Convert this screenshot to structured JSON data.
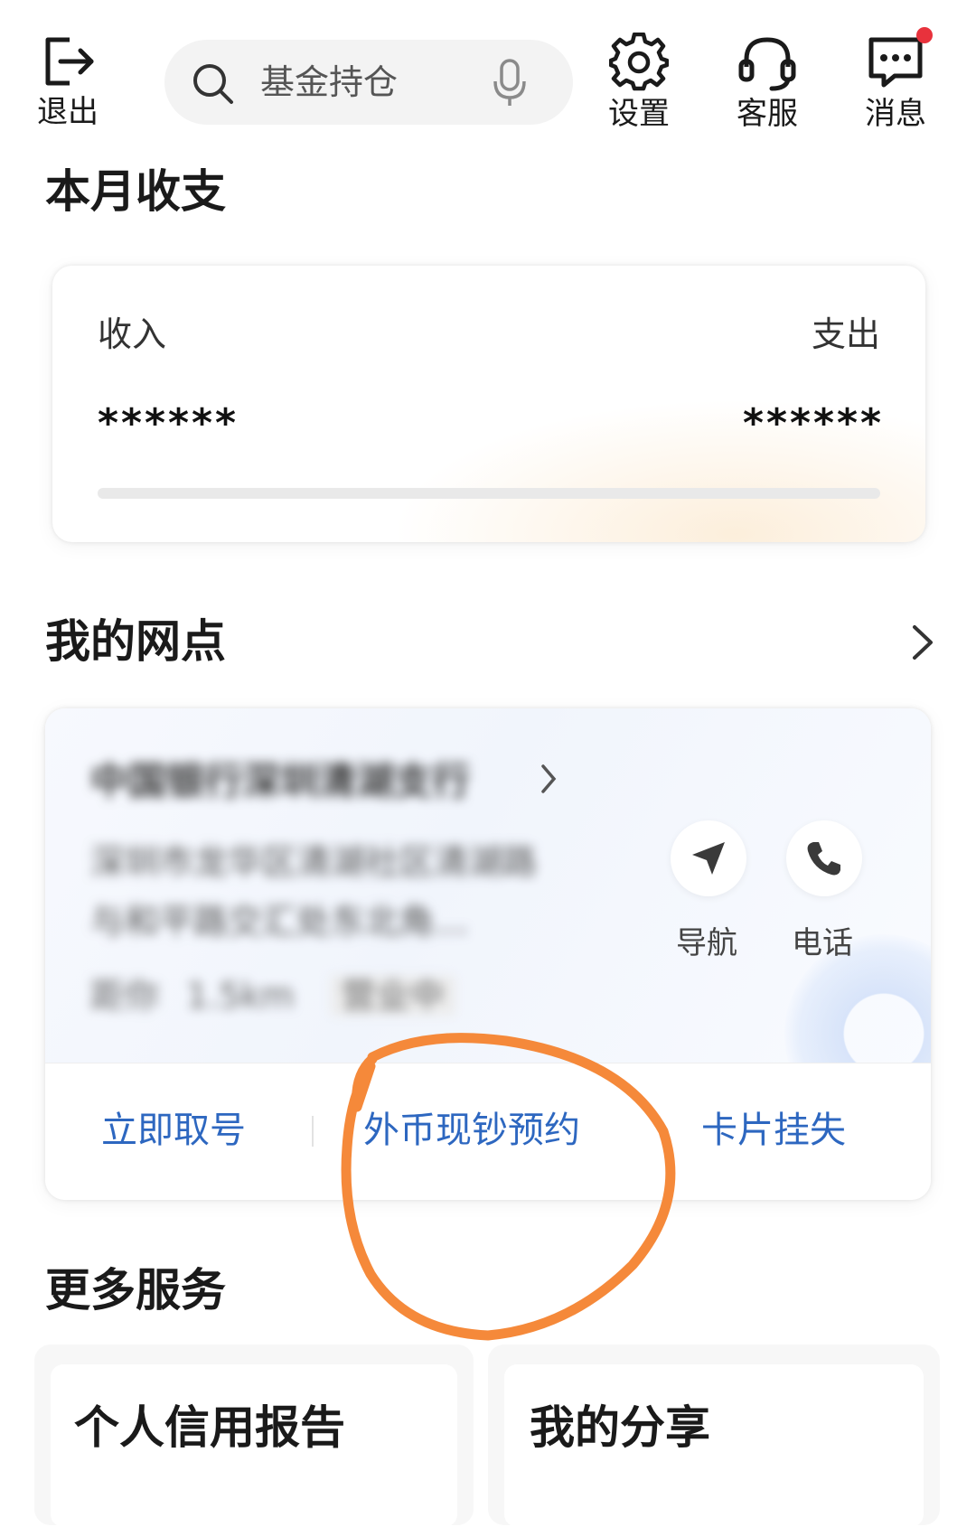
{
  "top_bar": {
    "logout_label": "退出",
    "search_placeholder": "基金持仓",
    "settings_label": "设置",
    "service_label": "客服",
    "messages_label": "消息",
    "has_unread": true
  },
  "monthly": {
    "title": "本月收支",
    "income_label": "收入",
    "expense_label": "支出",
    "income_value": "******",
    "expense_value": "******",
    "progress": 0
  },
  "branch": {
    "section_title": "我的网点",
    "name": "中国银行深圳清湖支行",
    "address_line1": "深圳市龙华区清湖社区清湖路",
    "address_line2": "与和平路交汇处东北角…",
    "distance_prefix": "距你",
    "distance_value": "1.5km",
    "hours": "营业中",
    "nav_label": "导航",
    "phone_label": "电话",
    "actions": [
      {
        "label": "立即取号"
      },
      {
        "label": "外币现钞预约"
      },
      {
        "label": "卡片挂失"
      }
    ]
  },
  "more_services": {
    "title": "更多服务",
    "items": [
      {
        "label": "个人信用报告"
      },
      {
        "label": "我的分享"
      }
    ]
  },
  "colors": {
    "link_blue": "#2d67c0",
    "annotation_orange": "#f5893a",
    "badge_red": "#e8323c"
  }
}
